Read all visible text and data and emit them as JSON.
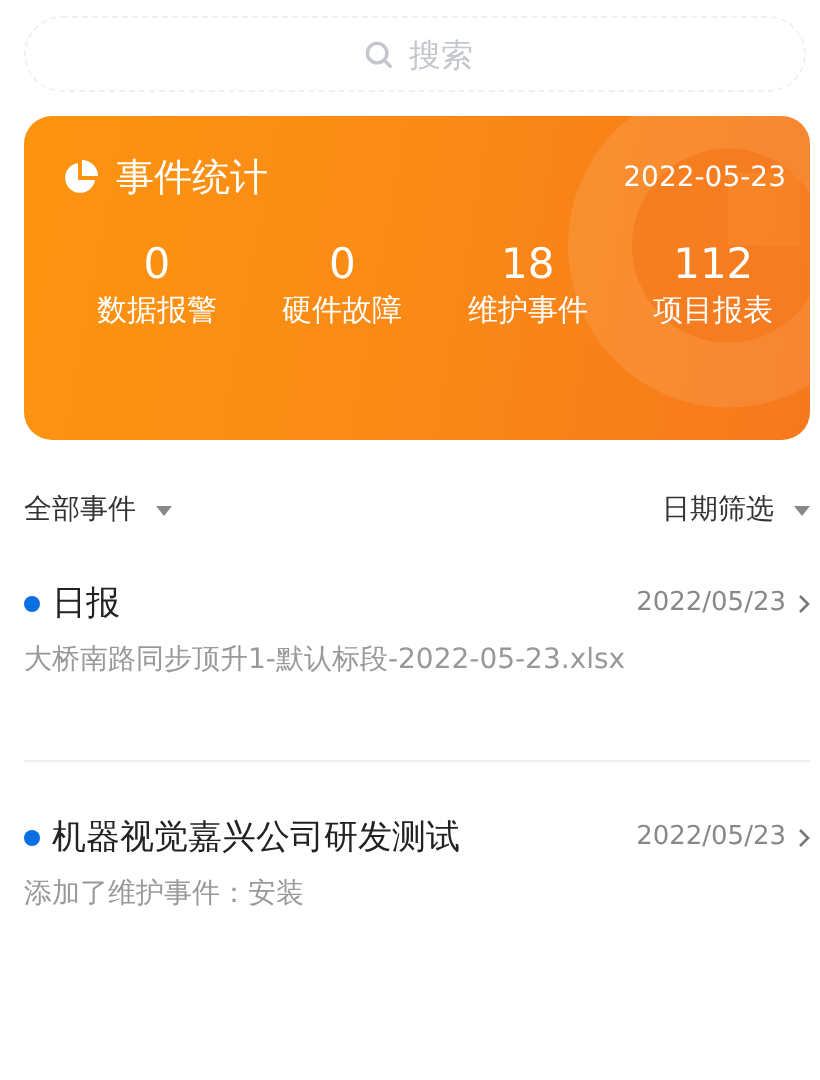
{
  "search": {
    "placeholder": "搜索"
  },
  "summary": {
    "title": "事件统计",
    "date": "2022-05-23",
    "stats": [
      {
        "value": "0",
        "label": "数据报警"
      },
      {
        "value": "0",
        "label": "硬件故障"
      },
      {
        "value": "18",
        "label": "维护事件"
      },
      {
        "value": "112",
        "label": "项目报表"
      }
    ]
  },
  "filters": {
    "category": "全部事件",
    "date": "日期筛选"
  },
  "events": [
    {
      "title": "日报",
      "date": "2022/05/23",
      "detail": "大桥南路同步顶升1-默认标段-2022-05-23.xlsx"
    },
    {
      "title": "机器视觉嘉兴公司研发测试",
      "date": "2022/05/23",
      "detail": "添加了维护事件：安装"
    }
  ]
}
